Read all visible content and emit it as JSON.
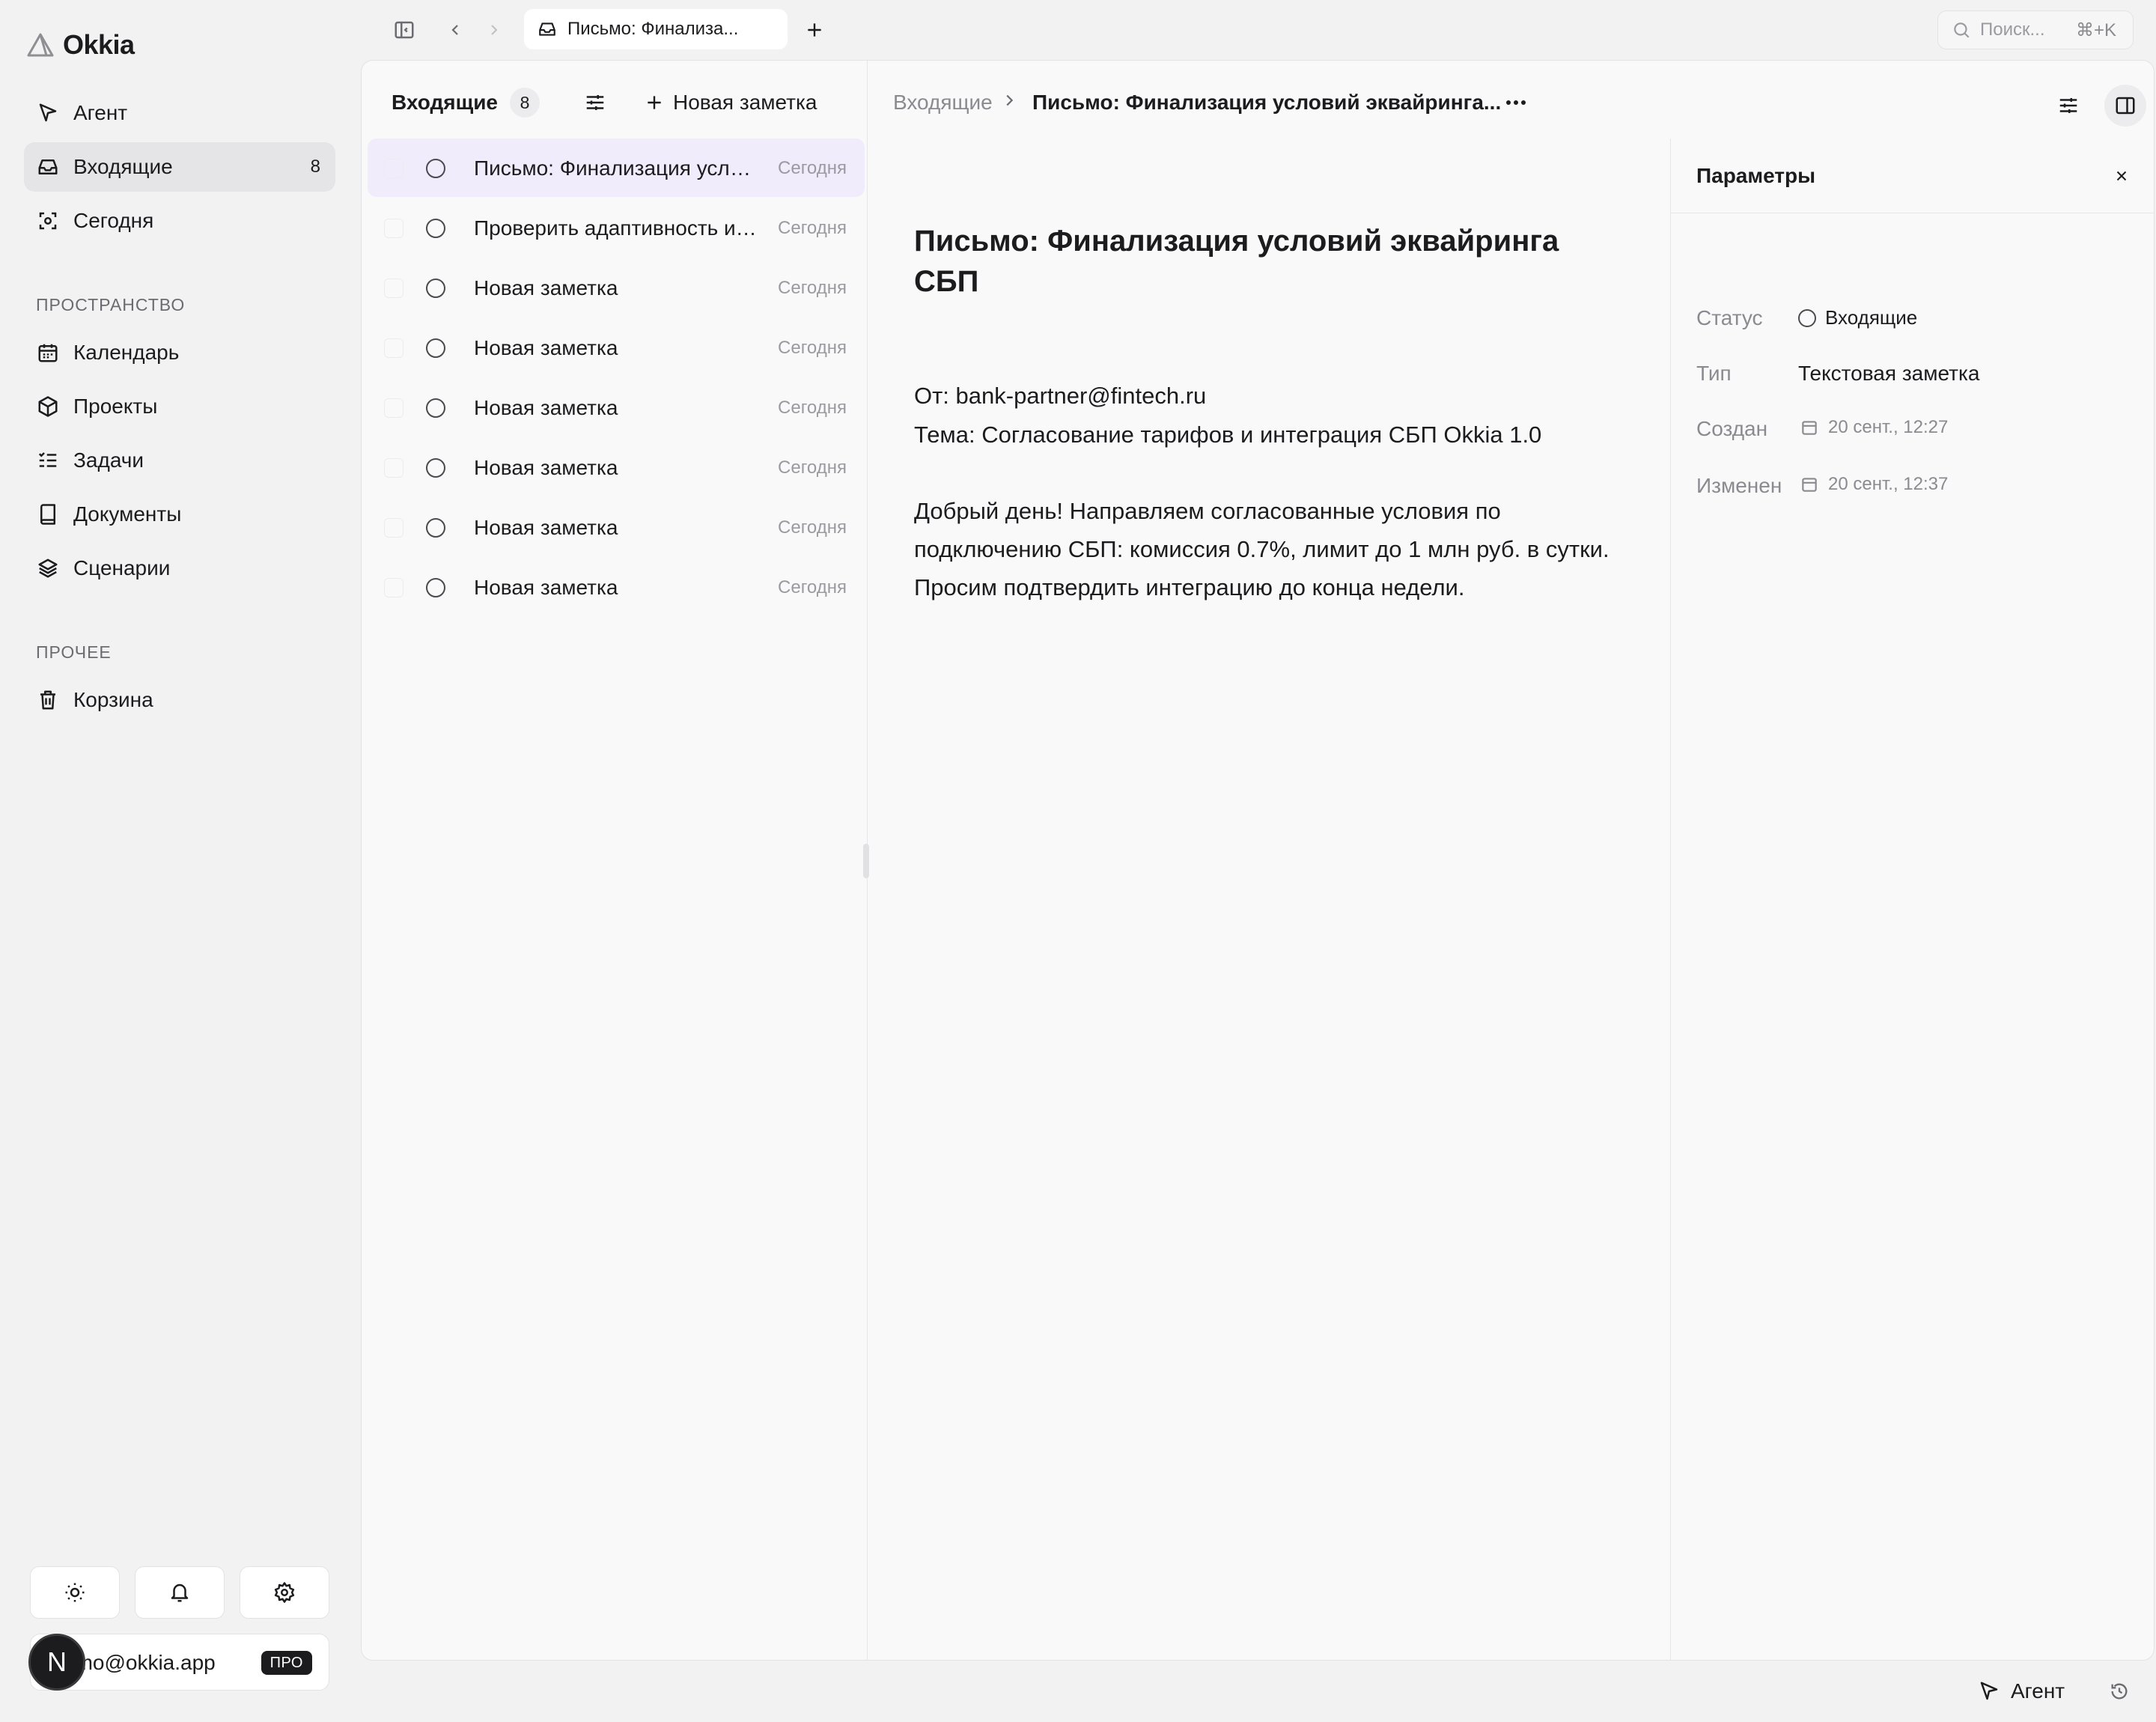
{
  "app": {
    "name": "Okkia",
    "tab_title": "Письмо: Финализа...",
    "search_placeholder": "Поиск...",
    "search_shortcut": "⌘+K"
  },
  "sidebar": {
    "items": [
      {
        "label": "Агент",
        "icon": "cursor-arrow-icon"
      },
      {
        "label": "Входящие",
        "icon": "inbox-icon",
        "count": "8",
        "active": true
      },
      {
        "label": "Сегодня",
        "icon": "focus-icon"
      }
    ],
    "space_title": "ПРОСТРАНСТВО",
    "space_items": [
      {
        "label": "Календарь",
        "icon": "calendar-icon"
      },
      {
        "label": "Проекты",
        "icon": "cube-icon"
      },
      {
        "label": "Задачи",
        "icon": "checklist-icon"
      },
      {
        "label": "Документы",
        "icon": "book-icon"
      },
      {
        "label": "Сценарии",
        "icon": "layers-icon"
      }
    ],
    "other_title": "ПРОЧЕЕ",
    "other_items": [
      {
        "label": "Корзина",
        "icon": "trash-icon"
      }
    ],
    "user": {
      "email": "emo@okkia.app",
      "plan": "ПРО",
      "avatar_letter": "N"
    }
  },
  "list": {
    "title": "Входящие",
    "count": "8",
    "new_note_label": "Новая заметка",
    "rows": [
      {
        "title": "Письмо: Финализация условий эквайринга СБП",
        "date": "Сегодня",
        "selected": true
      },
      {
        "title": "Проверить адаптивность интерфейса",
        "date": "Сегодня"
      },
      {
        "title": "Новая заметка",
        "date": "Сегодня"
      },
      {
        "title": "Новая заметка",
        "date": "Сегодня"
      },
      {
        "title": "Новая заметка",
        "date": "Сегодня"
      },
      {
        "title": "Новая заметка",
        "date": "Сегодня"
      },
      {
        "title": "Новая заметка",
        "date": "Сегодня"
      },
      {
        "title": "Новая заметка",
        "date": "Сегодня"
      }
    ]
  },
  "document": {
    "breadcrumb_root": "Входящие",
    "breadcrumb_current": "Письмо: Финализация условий эквайринга...",
    "title": "Письмо: Финализация условий эквайринга СБП",
    "from_line": "От: bank-partner@fintech.ru",
    "subject_line": "Тема: Согласование тарифов и интеграция СБП Okkia 1.0",
    "body": "Добрый день! Направляем согласованные условия по подключению СБП: комиссия 0.7%, лимит до 1 млн руб. в сутки. Просим подтвердить интеграцию до конца недели."
  },
  "params": {
    "title": "Параметры",
    "status_label": "Статус",
    "status_value": "Входящие",
    "type_label": "Тип",
    "type_value": "Текстовая заметка",
    "created_label": "Создан",
    "created_value": "20 сент., 12:27",
    "modified_label": "Изменен",
    "modified_value": "20 сент., 12:37"
  },
  "footer": {
    "agent_label": "Агент"
  }
}
